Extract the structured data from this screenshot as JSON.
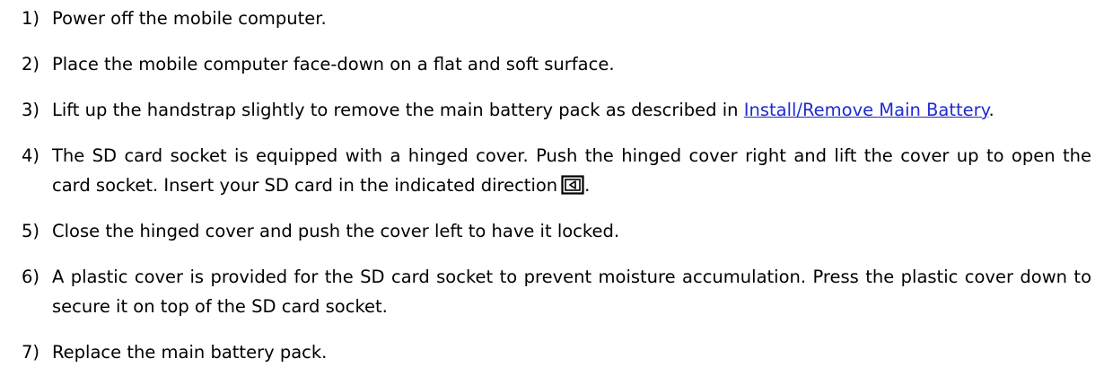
{
  "steps": [
    {
      "number": "1)",
      "text": "Power off the mobile computer."
    },
    {
      "number": "2)",
      "text": "Place the mobile computer face-down on a flat and soft surface."
    },
    {
      "number": "3)",
      "text_before": "Lift up the handstrap slightly to remove the main battery pack as described in ",
      "link_text": "Install/Remove Main Battery",
      "text_after": "."
    },
    {
      "number": "4)",
      "text_before": "The SD card socket is equipped with a hinged cover. Push the hinged cover right and lift the cover up to open the card socket. Insert your SD card in the indicated direction",
      "icon": "sd-card-direction-icon",
      "text_after": "."
    },
    {
      "number": "5)",
      "text": "Close the hinged cover and push the cover left to have it locked."
    },
    {
      "number": "6)",
      "text": "A plastic cover is provided for the SD card socket to prevent moisture accumulation. Press the plastic cover down to secure it on top of the SD card socket."
    },
    {
      "number": "7)",
      "text": "Replace the main battery pack."
    }
  ],
  "colors": {
    "link": "#1f2bd0",
    "text": "#000000"
  }
}
